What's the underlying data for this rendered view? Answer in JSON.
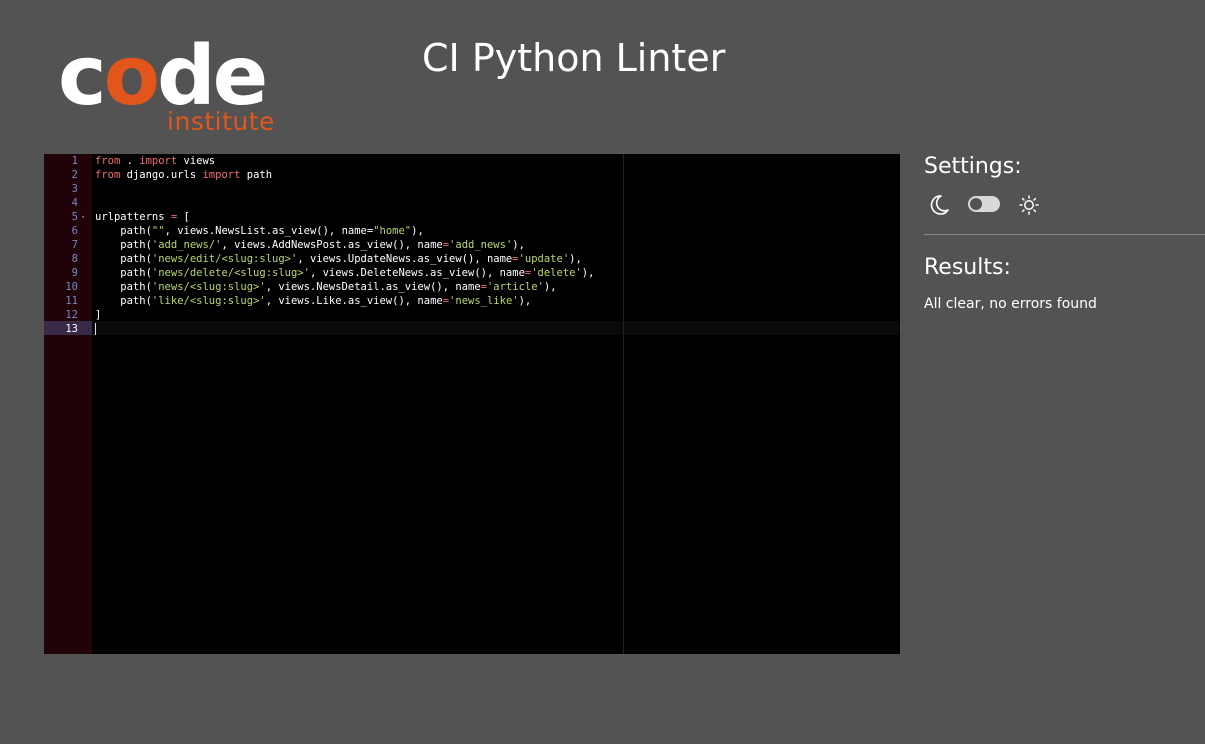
{
  "logo": {
    "word_c": "c",
    "word_o": "o",
    "word_de": "de",
    "sub": "institute"
  },
  "header": {
    "title": "CI Python Linter"
  },
  "editor": {
    "line_numbers": [
      "1",
      "2",
      "3",
      "4",
      "5",
      "6",
      "7",
      "8",
      "9",
      "10",
      "11",
      "12",
      "13"
    ],
    "active_line": "13",
    "fold_marker_line": "5",
    "lines": [
      [
        {
          "t": "from",
          "c": "kw"
        },
        {
          "t": " . ",
          "c": "plain"
        },
        {
          "t": "import",
          "c": "kw"
        },
        {
          "t": " views",
          "c": "plain"
        }
      ],
      [
        {
          "t": "from",
          "c": "kw"
        },
        {
          "t": " django.urls ",
          "c": "plain"
        },
        {
          "t": "import",
          "c": "kw"
        },
        {
          "t": " path",
          "c": "plain"
        }
      ],
      [],
      [],
      [
        {
          "t": "urlpatterns ",
          "c": "plain"
        },
        {
          "t": "=",
          "c": "op"
        },
        {
          "t": " [",
          "c": "plain"
        }
      ],
      [
        {
          "t": "    path(",
          "c": "plain"
        },
        {
          "t": "\"\"",
          "c": "str"
        },
        {
          "t": ", views.NewsList.as_view(), name=",
          "c": "plain"
        },
        {
          "t": "\"home\"",
          "c": "str"
        },
        {
          "t": "),",
          "c": "plain"
        }
      ],
      [
        {
          "t": "    path(",
          "c": "plain"
        },
        {
          "t": "'add_news/'",
          "c": "str"
        },
        {
          "t": ", views.AddNewsPost.as_view(), name",
          "c": "plain"
        },
        {
          "t": "=",
          "c": "op"
        },
        {
          "t": "'add_news'",
          "c": "str"
        },
        {
          "t": "),",
          "c": "plain"
        }
      ],
      [
        {
          "t": "    path(",
          "c": "plain"
        },
        {
          "t": "'news/edit/<slug:slug>'",
          "c": "str"
        },
        {
          "t": ", views.UpdateNews.as_view(), name",
          "c": "plain"
        },
        {
          "t": "=",
          "c": "op"
        },
        {
          "t": "'update'",
          "c": "str"
        },
        {
          "t": "),",
          "c": "plain"
        }
      ],
      [
        {
          "t": "    path(",
          "c": "plain"
        },
        {
          "t": "'news/delete/<slug:slug>'",
          "c": "str"
        },
        {
          "t": ", views.DeleteNews.as_view(), name",
          "c": "plain"
        },
        {
          "t": "=",
          "c": "op"
        },
        {
          "t": "'delete'",
          "c": "str"
        },
        {
          "t": "),",
          "c": "plain"
        }
      ],
      [
        {
          "t": "    path(",
          "c": "plain"
        },
        {
          "t": "'news/<slug:slug>'",
          "c": "str"
        },
        {
          "t": ", views.NewsDetail.as_view(), name",
          "c": "plain"
        },
        {
          "t": "=",
          "c": "op"
        },
        {
          "t": "'article'",
          "c": "str"
        },
        {
          "t": "),",
          "c": "plain"
        }
      ],
      [
        {
          "t": "    path(",
          "c": "plain"
        },
        {
          "t": "'like/<slug:slug>'",
          "c": "str"
        },
        {
          "t": ", views.Like.as_view(), name",
          "c": "plain"
        },
        {
          "t": "=",
          "c": "op"
        },
        {
          "t": "'news_like'",
          "c": "str"
        },
        {
          "t": "),",
          "c": "plain"
        }
      ],
      [
        {
          "t": "]",
          "c": "plain"
        }
      ],
      []
    ],
    "syntax_colors": {
      "kw": "#f26d6d",
      "str": "#b8d86b",
      "op": "#f26d6d",
      "plain": "#ffffff"
    },
    "background": "#000000",
    "gutter_color": "#200308"
  },
  "settings": {
    "title": "Settings:",
    "dark_icon": "moon-icon",
    "toggle_state": "dark",
    "light_icon": "sun-icon"
  },
  "results": {
    "title": "Results:",
    "message": "All clear, no errors found"
  },
  "colors": {
    "page_background": "#535353",
    "brand_orange": "#e2561c"
  }
}
